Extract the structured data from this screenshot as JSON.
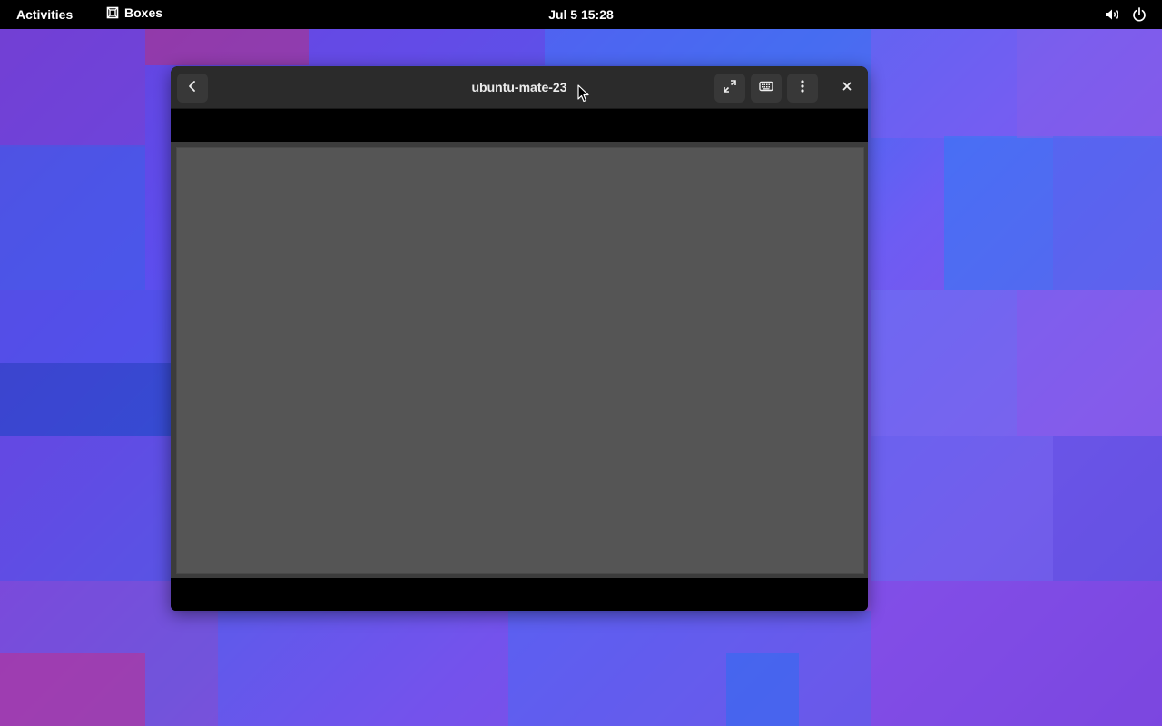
{
  "topbar": {
    "activities_label": "Activities",
    "app_name": "Boxes",
    "app_icon": "boxes-icon",
    "clock": "Jul 5  15:28",
    "tray_icons": [
      "volume-icon",
      "power-icon"
    ]
  },
  "window": {
    "title": "ubuntu-mate-23",
    "buttons": {
      "back": "back-icon",
      "fullscreen": "fullscreen-icon",
      "keyboard": "keyboard-icon",
      "menu": "menu-icon",
      "close": "close-icon"
    },
    "display_state": "blank"
  },
  "colors": {
    "topbar_bg": "#000000",
    "headerbar_bg": "#2b2b2b",
    "button_bg": "#383838",
    "vm_screen_bg": "#555555",
    "wallpaper_primary": "#5b4ff0",
    "wallpaper_secondary": "#8a4fe6"
  }
}
